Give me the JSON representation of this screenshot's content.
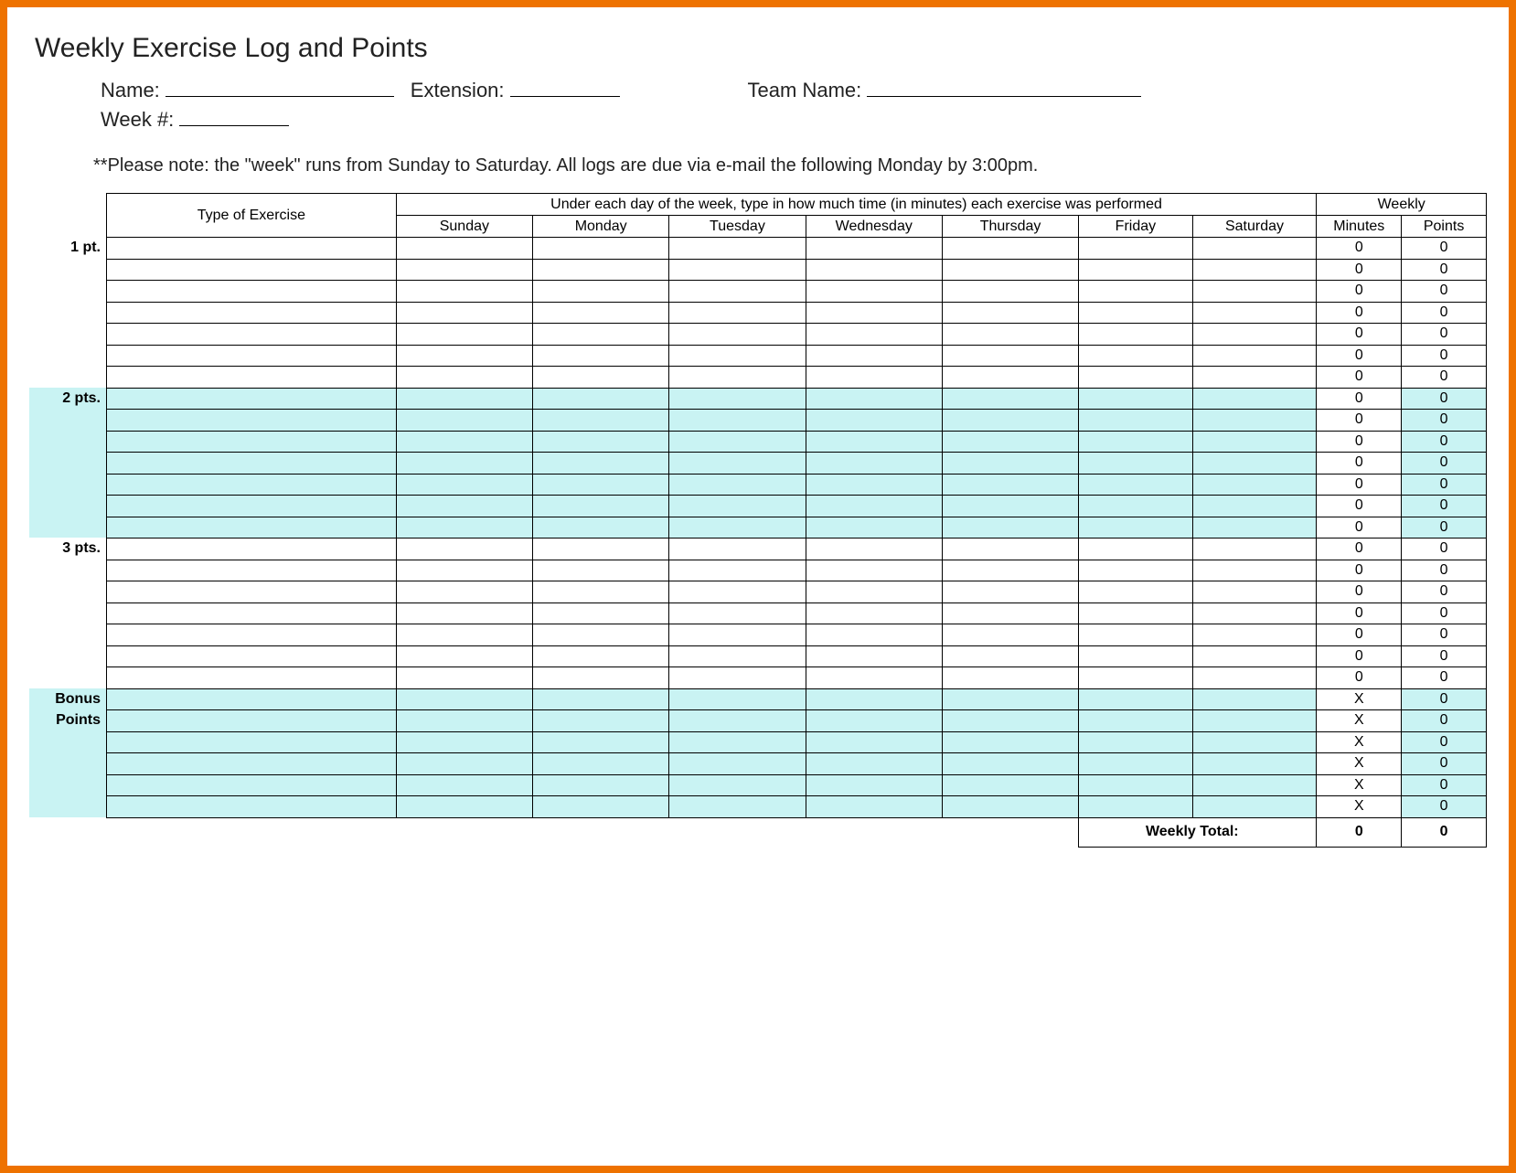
{
  "title": "Weekly Exercise Log and Points",
  "fields": {
    "name_label": "Name:",
    "extension_label": "Extension:",
    "team_label": "Team Name:",
    "week_label": "Week #:"
  },
  "note": "**Please note: the \"week\" runs from Sunday to Saturday.  All logs are due via e-mail the following Monday by 3:00pm.",
  "headers": {
    "exercise": "Type of Exercise",
    "day_note": "Under each day of the week, type in how much time (in minutes) each exercise was performed",
    "weekly": "Weekly",
    "days": [
      "Sunday",
      "Monday",
      "Tuesday",
      "Wednesday",
      "Thursday",
      "Friday",
      "Saturday"
    ],
    "minutes": "Minutes",
    "points": "Points"
  },
  "pt_labels": {
    "p1": "1 pt.",
    "p2": "2 pts.",
    "p3": "3 pts.",
    "bonus1": "Bonus",
    "bonus2": "Points"
  },
  "sections": [
    {
      "label": "1 pt.",
      "color": "white",
      "rows": 7
    },
    {
      "label": "2 pts.",
      "color": "blue",
      "rows": 7
    },
    {
      "label": "3 pts.",
      "color": "white",
      "rows": 7
    },
    {
      "label": "Bonus Points",
      "color": "blue",
      "rows": 6,
      "minutes_x": true
    }
  ],
  "default_minutes": "0",
  "default_points": "0",
  "x_value": "X",
  "total_label": "Weekly Total:",
  "total_minutes": "0",
  "total_points": "0"
}
